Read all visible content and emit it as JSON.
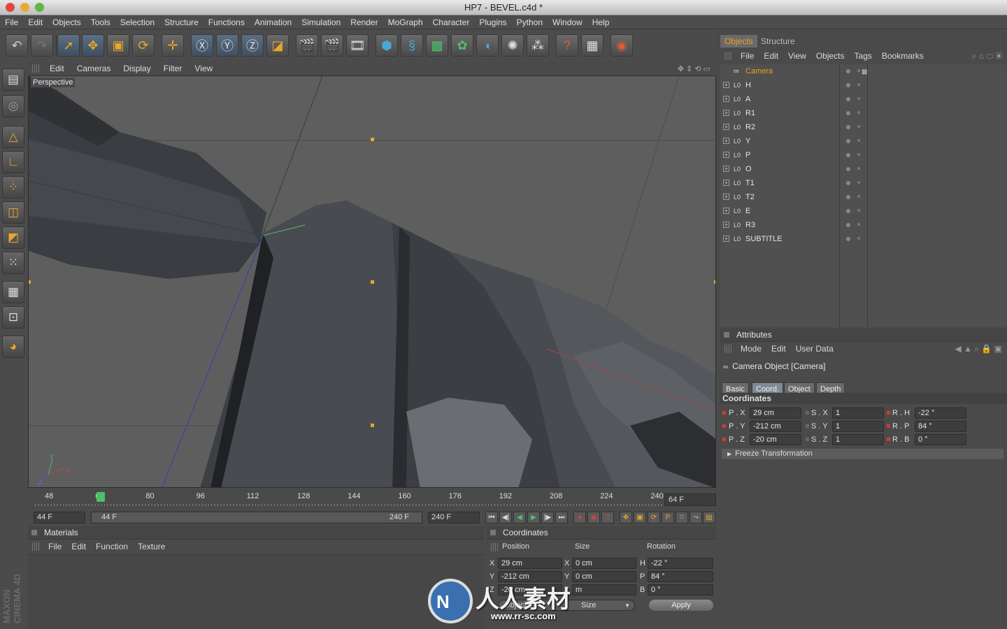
{
  "window": {
    "title": "HP7 - BEVEL.c4d *"
  },
  "menubar": [
    "File",
    "Edit",
    "Objects",
    "Tools",
    "Selection",
    "Structure",
    "Functions",
    "Animation",
    "Simulation",
    "Render",
    "MoGraph",
    "Character",
    "Plugins",
    "Python",
    "Window",
    "Help"
  ],
  "viewport": {
    "menu": [
      "Edit",
      "Cameras",
      "Display",
      "Filter",
      "View"
    ],
    "label": "Perspective"
  },
  "timeline": {
    "ticks": [
      "48",
      "64",
      "80",
      "96",
      "112",
      "128",
      "144",
      "160",
      "176",
      "192",
      "208",
      "224",
      "240"
    ],
    "current_frame": "64 F",
    "start_field": "44 F",
    "range_start": "44 F",
    "range_end": "240 F",
    "end_field": "240 F"
  },
  "materials": {
    "title": "Materials",
    "menu": [
      "File",
      "Edit",
      "Function",
      "Texture"
    ]
  },
  "coordinates": {
    "title": "Coordinates",
    "headers": [
      "Position",
      "Size",
      "Rotation"
    ],
    "rows": [
      {
        "axis": "X",
        "pos": "29 cm",
        "size_axis": "X",
        "size": "0 cm",
        "rot_axis": "H",
        "rot": "-22 °"
      },
      {
        "axis": "Y",
        "pos": "-212 cm",
        "size_axis": "Y",
        "size": "0 cm",
        "rot_axis": "P",
        "rot": "84 °"
      },
      {
        "axis": "Z",
        "pos": "-20 cm",
        "size_axis": "Z",
        "size": "m",
        "rot_axis": "B",
        "rot": "0 °"
      }
    ],
    "mode_select": "Object",
    "size_select": "Size",
    "apply": "Apply"
  },
  "objects_panel": {
    "tabs": [
      "Objects",
      "Structure"
    ],
    "menu": [
      "File",
      "Edit",
      "View",
      "Objects",
      "Tags",
      "Bookmarks"
    ],
    "items": [
      "Camera",
      "H",
      "A",
      "R1",
      "R2",
      "Y",
      "P",
      "O",
      "T1",
      "T2",
      "E",
      "R3",
      "SUBTITLE"
    ]
  },
  "attributes": {
    "title": "Attributes",
    "menu": [
      "Mode",
      "Edit",
      "User Data"
    ],
    "object_label": "Camera Object [Camera]",
    "tabs": [
      "Basic",
      "Coord.",
      "Object",
      "Depth"
    ],
    "section": "Coordinates",
    "rows": [
      {
        "p_label": "P . X",
        "p": "29 cm",
        "s_label": "S . X",
        "s": "1",
        "r_label": "R . H",
        "r": "-22 °"
      },
      {
        "p_label": "P . Y",
        "p": "-212 cm",
        "s_label": "S . Y",
        "s": "1",
        "r_label": "R . P",
        "r": "84 °"
      },
      {
        "p_label": "P . Z",
        "p": "-20 cm",
        "s_label": "S . Z",
        "s": "1",
        "r_label": "R . B",
        "r": "0 °"
      }
    ],
    "freeze": "Freeze Transformation"
  },
  "branding": {
    "vertical": "MAXON CINEMA 4D",
    "watermark_text": "人人素材",
    "watermark_url": "www.rr-sc.com"
  },
  "colors": {
    "accent_orange": "#e9a62a",
    "selected_tab": "#7f8a96",
    "camera_label": "#f0a020"
  }
}
